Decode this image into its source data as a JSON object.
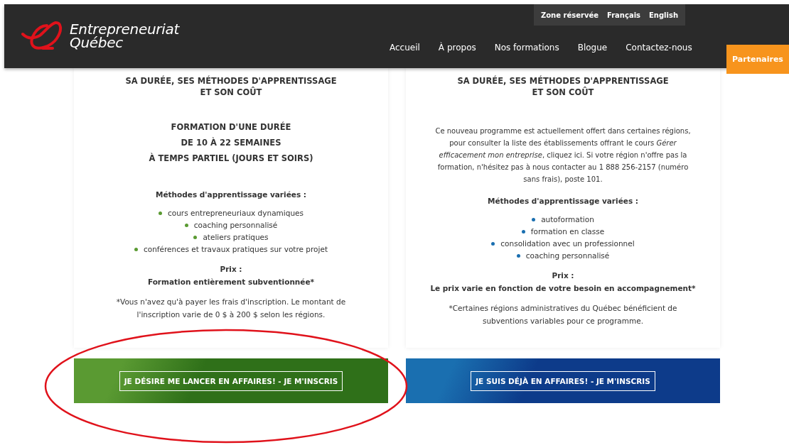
{
  "header": {
    "logo_line_1": "Entrepreneuriat",
    "logo_line_2": "Québec",
    "top_links": [
      {
        "label": "Zone réservée"
      },
      {
        "label": "Français"
      },
      {
        "label": "English"
      }
    ],
    "nav": [
      {
        "label": "Accueil"
      },
      {
        "label": "À propos"
      },
      {
        "label": "Nos formations"
      },
      {
        "label": "Blogue"
      },
      {
        "label": "Contactez-nous"
      }
    ],
    "partners_tab": "Partenaires"
  },
  "cards": [
    {
      "color": "#5a9a32",
      "heading_line_1": "SA DURÉE, SES MÉTHODES D'APPRENTISSAGE",
      "heading_line_2": "ET SON COÛT",
      "duration_lines": [
        "FORMATION D'UNE DURÉE",
        "DE 10 À 22 SEMAINES",
        "À TEMPS PARTIEL (JOURS ET SOIRS)"
      ],
      "methods_title": "Méthodes d'apprentissage variées :",
      "methods": [
        "cours entrepreneuriaux dynamiques",
        "coaching personnalisé",
        "ateliers pratiques",
        "conférences et travaux pratiques sur votre projet"
      ],
      "price_label": "Prix :",
      "price_value": "Formation entièrement subventionnée*",
      "footnote": "*Vous n'avez qu'à payer les frais d'inscription. Le montant de l'inscription varie de 0 $ à 200 $ selon les régions.",
      "button": "JE DÉSIRE ME LANCER EN AFFAIRES! - JE M'INSCRIS"
    },
    {
      "color": "#1a6fb0",
      "heading_line_1": "SA DURÉE, SES MÉTHODES D'APPRENTISSAGE",
      "heading_line_2": "ET SON COÛT",
      "intro": "Ce nouveau programme est actuellement offert dans certaines régions, pour consulter la liste des établissements offrant le cours *Gérer efficacement mon entreprise*, cliquez ici. Si votre région n'offre pas la formation, n'hésitez pas à nous contacter au 1 888 256-2157 (numéro sans frais), poste 101.",
      "methods_title": "Méthodes d'apprentissage variées :",
      "methods": [
        "autoformation",
        "formation en classe",
        "consolidation avec un professionnel",
        "coaching personnalisé"
      ],
      "price_label": "Prix :",
      "price_value": "Le prix varie en fonction de votre besoin en accompagnement*",
      "footnote": "*Certaines régions administratives du Québec bénéficient de subventions variables pour ce programme.",
      "button": "JE SUIS DÉJÀ EN AFFAIRES! - JE M'INSCRIS"
    }
  ],
  "annotation": {
    "kind": "ellipse"
  }
}
